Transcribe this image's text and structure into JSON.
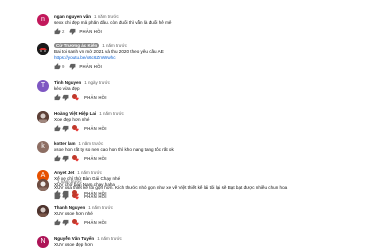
{
  "comments": [
    {
      "author": "ngan nguyen vǎn",
      "time": "1 năm trước",
      "lines": [
        "sexx chi đẹp mả phăn đâu. còn đuổi thì vẫn là đuổi hê mê"
      ],
      "link": "",
      "likes": "2",
      "reply": "PHẢN HỒI",
      "avatar_letter": "n",
      "avatar_color": "#c2185b",
      "highlighted": false,
      "hearted": false
    },
    {
      "author": "Cử Trương ác Kiến",
      "time": "1 năm trước",
      "lines": [
        "Bai toi sanh vn mờ 2021 và thu 2020 theo yêu cầu AE"
      ],
      "link": "https://youtu.be/x6c6ZmWwhc",
      "likes": "9",
      "reply": "PHẢN HỒI",
      "avatar_letter": "",
      "avatar_color": "#1a1a1a",
      "highlighted": true,
      "hearted": false
    },
    {
      "author": "Tình Nguyen",
      "time": "1 ngày trước",
      "lines": [
        "kèo vừa đẹp"
      ],
      "link": "",
      "likes": "",
      "reply": "PHẢN HỒI",
      "avatar_letter": "T",
      "avatar_color": "#7e57c2",
      "highlighted": false,
      "hearted": true
    },
    {
      "author": "Hoàng Việt Hiệp Lai",
      "time": "1 năm trước",
      "lines": [
        "Xoe đẹp hơn nhé"
      ],
      "link": "",
      "likes": "",
      "reply": "PHẢN HỒI",
      "avatar_letter": "",
      "avatar_color": "#5d4037",
      "highlighted": false,
      "hearted": true
    },
    {
      "author": "kotter lam",
      "time": "1 năm trước",
      "lines": [
        "xsoe hon rất ty so nen cao hon thì kho nang tang tôc rất ok"
      ],
      "link": "",
      "likes": "",
      "reply": "PHẢN HỒI",
      "avatar_letter": "k",
      "avatar_color": "#8d6e63",
      "highlighted": false,
      "hearted": true
    },
    {
      "author": "Anyet Jet",
      "time": "1 năm trước",
      "lines": [
        "Xế xe chí thử Bàn Gái Chạy nhé",
        "XUV chở bạn Nam chạy haha"
      ],
      "link": "",
      "likes": "",
      "reply": "PHẢN HỒI",
      "avatar_letter": "A",
      "avatar_color": "#e65100",
      "highlighted": false,
      "hearted": true
    },
    {
      "author": "",
      "time": "1 năm trước",
      "lines": [
        "XUV xsa thiết kế tôi gọn hơn. Kích thước nhỏ gọn như xe về Việt thiết kế lái tôi lại sẽ Bạt bạt được nhiều chun hoa"
      ],
      "link": "",
      "likes": "",
      "reply": "PHẢN HỒI",
      "avatar_letter": "",
      "avatar_color": "#6d4c41",
      "highlighted": false,
      "hearted": true
    },
    {
      "author": "Thanh Nguyen",
      "time": "1 năm trước",
      "lines": [
        "XUV xsoe hơn nhé"
      ],
      "link": "",
      "likes": "",
      "reply": "PHẢN HỒI",
      "avatar_letter": "",
      "avatar_color": "#4e342e",
      "highlighted": false,
      "hearted": true
    },
    {
      "author": "Nguyễn Văn Tuyển",
      "time": "1 năm trước",
      "lines": [
        "XUV xsoe đẹp hơn"
      ],
      "link": "",
      "likes": "",
      "reply": "",
      "avatar_letter": "N",
      "avatar_color": "#ad1457",
      "highlighted": false,
      "hearted": false
    }
  ]
}
